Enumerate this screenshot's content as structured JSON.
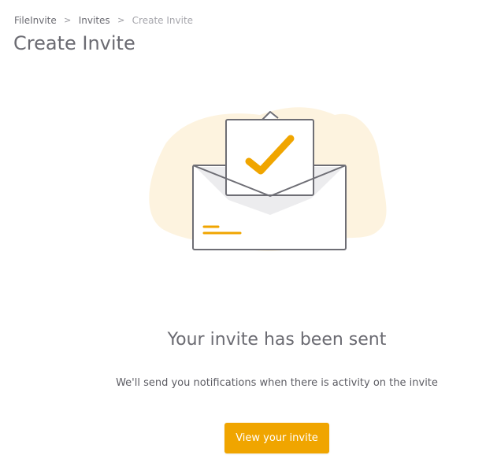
{
  "breadcrumb": {
    "items": [
      {
        "label": "FileInvite"
      },
      {
        "label": "Invites"
      },
      {
        "label": "Create Invite"
      }
    ],
    "separator": ">"
  },
  "header": {
    "title": "Create Invite"
  },
  "illustration": {
    "icon": "envelope-checkmark-icon",
    "colors": {
      "blob": "#fdf3df",
      "stroke": "#6e6e75",
      "checkmark": "#f0a500",
      "inner_shadow": "#ececee"
    }
  },
  "confirmation": {
    "headline": "Your invite has been sent",
    "message": "We'll send you notifications when there is activity on the invite"
  },
  "actions": {
    "view_invite_label": "View your invite",
    "accent_color": "#f0a500"
  }
}
